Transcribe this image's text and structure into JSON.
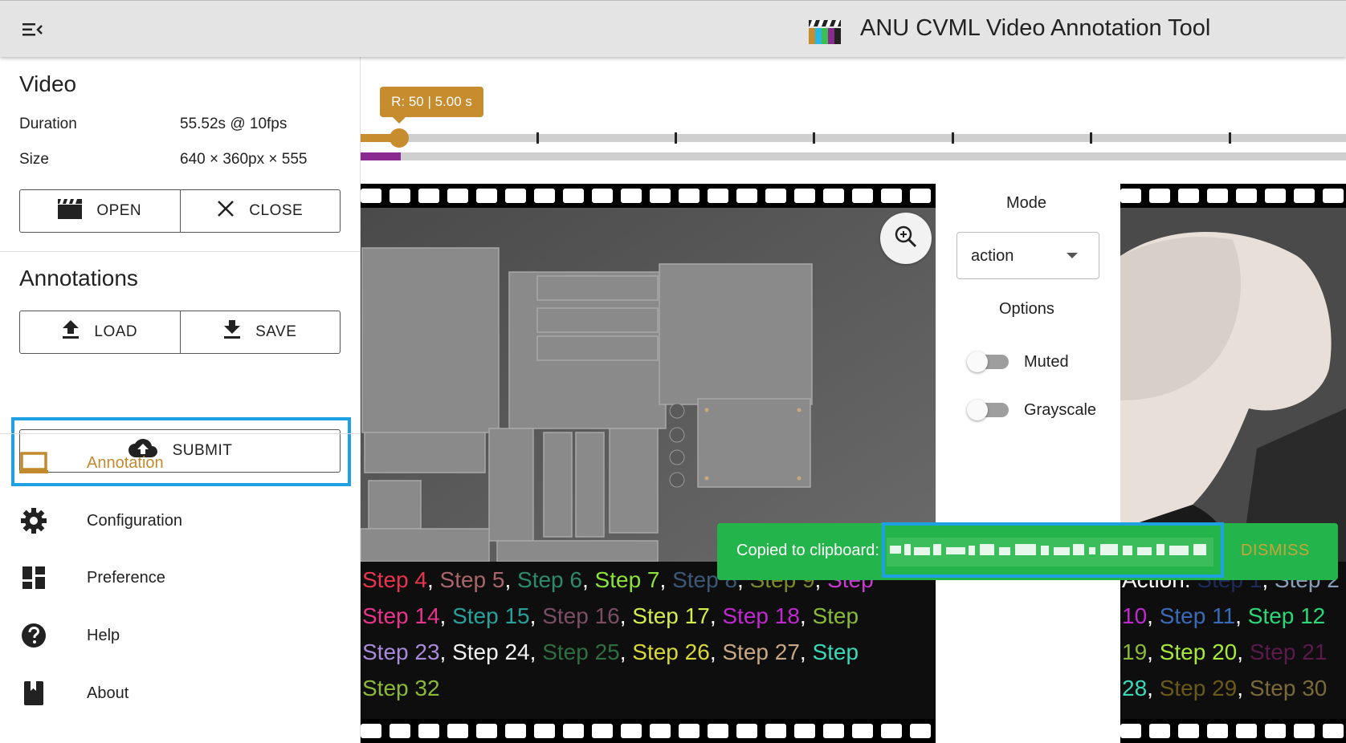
{
  "appbar": {
    "title": "ANU CVML Video Annotation Tool",
    "menu_icon": "menu-collapse-icon",
    "logo_icon": "clapperboard-logo-icon"
  },
  "sidebar": {
    "video": {
      "title": "Video",
      "duration_label": "Duration",
      "duration_value": "55.52s @ 10fps",
      "size_label": "Size",
      "size_value": "640 × 360px × 555",
      "open_label": "OPEN",
      "close_label": "CLOSE"
    },
    "annotations": {
      "title": "Annotations",
      "load_label": "LOAD",
      "save_label": "SAVE",
      "submit_label": "SUBMIT"
    },
    "nav": [
      {
        "label": "Annotation",
        "icon": "laptop-icon",
        "active": true
      },
      {
        "label": "Configuration",
        "icon": "gear-icon",
        "active": false
      },
      {
        "label": "Preference",
        "icon": "dashboard-icon",
        "active": false
      },
      {
        "label": "Help",
        "icon": "help-icon",
        "active": false
      },
      {
        "label": "About",
        "icon": "book-icon",
        "active": false
      }
    ]
  },
  "timeline": {
    "tooltip": "R: 50 | 5.00 s",
    "position_frame": 50,
    "total_frames": 555
  },
  "left_frame": {
    "lines": [
      [
        {
          "t": "Step 4",
          "c": "#e8344e"
        },
        {
          "t": ", ",
          "c": "#ffffff"
        },
        {
          "t": "Step 5",
          "c": "#a8656b"
        },
        {
          "t": ", ",
          "c": "#ffffff"
        },
        {
          "t": "Step 6",
          "c": "#2e8a6c"
        },
        {
          "t": ", ",
          "c": "#ffffff"
        },
        {
          "t": "Step 7",
          "c": "#8ee03a"
        },
        {
          "t": ", ",
          "c": "#ffffff"
        },
        {
          "t": "Step 8",
          "c": "#3c5878"
        },
        {
          "t": ", ",
          "c": "#ffffff"
        },
        {
          "t": "Step 9",
          "c": "#7a8a2a"
        },
        {
          "t": ", ",
          "c": "#ffffff"
        },
        {
          "t": "Step",
          "c": "#c83ad0"
        }
      ],
      [
        {
          "t": "Step 14",
          "c": "#e8348a"
        },
        {
          "t": ", ",
          "c": "#ffffff"
        },
        {
          "t": "Step 15",
          "c": "#2aa09a"
        },
        {
          "t": ", ",
          "c": "#ffffff"
        },
        {
          "t": "Step 16",
          "c": "#7a4e64"
        },
        {
          "t": ", ",
          "c": "#ffffff"
        },
        {
          "t": "Step 17",
          "c": "#d4ec4e"
        },
        {
          "t": ", ",
          "c": "#ffffff"
        },
        {
          "t": "Step 18",
          "c": "#c028d0"
        },
        {
          "t": ", ",
          "c": "#ffffff"
        },
        {
          "t": "Step",
          "c": "#8ab83a"
        }
      ],
      [
        {
          "t": "Step 23",
          "c": "#a88ad8"
        },
        {
          "t": ", ",
          "c": "#ffffff"
        },
        {
          "t": "Step 24",
          "c": "#f2f2f2"
        },
        {
          "t": ", ",
          "c": "#ffffff"
        },
        {
          "t": "Step 25",
          "c": "#2e6e40"
        },
        {
          "t": ", ",
          "c": "#ffffff"
        },
        {
          "t": "Step 26",
          "c": "#d8d838"
        },
        {
          "t": ", ",
          "c": "#ffffff"
        },
        {
          "t": "Step 27",
          "c": "#c8a882"
        },
        {
          "t": ", ",
          "c": "#ffffff"
        },
        {
          "t": "Step",
          "c": "#3ad8b8"
        }
      ],
      [
        {
          "t": "Step 32",
          "c": "#8ab83a"
        }
      ]
    ]
  },
  "right_frame": {
    "lines": [
      [
        {
          "t": "Action: ",
          "c": "#ffffff"
        },
        {
          "t": "Step 1",
          "c": "#1e2a5a"
        },
        {
          "t": ", ",
          "c": "#ffffff"
        },
        {
          "t": "Step 2",
          "c": "#8aa0b8"
        }
      ],
      [
        {
          "t": "10",
          "c": "#c028d0"
        },
        {
          "t": ", ",
          "c": "#ffffff"
        },
        {
          "t": "Step 11",
          "c": "#3a6ab8"
        },
        {
          "t": ", ",
          "c": "#ffffff"
        },
        {
          "t": "Step 12",
          "c": "#2ad87a"
        }
      ],
      [
        {
          "t": "19",
          "c": "#8ab83a"
        },
        {
          "t": ", ",
          "c": "#ffffff"
        },
        {
          "t": "Step 20",
          "c": "#a8e83a"
        },
        {
          "t": ", ",
          "c": "#ffffff"
        },
        {
          "t": "Step 21",
          "c": "#5a1a4a"
        }
      ],
      [
        {
          "t": "28",
          "c": "#3ad8b8"
        },
        {
          "t": ", ",
          "c": "#ffffff"
        },
        {
          "t": "Step 29",
          "c": "#6a5a1a"
        },
        {
          "t": ", ",
          "c": "#ffffff"
        },
        {
          "t": "Step 30",
          "c": "#7a6a3a"
        }
      ]
    ]
  },
  "controls": {
    "mode_label": "Mode",
    "mode_value": "action",
    "options_label": "Options",
    "muted_label": "Muted",
    "muted_on": false,
    "grayscale_label": "Grayscale",
    "grayscale_on": false,
    "zoom_icon": "zoom-in-icon"
  },
  "snackbar": {
    "text": "Copied to clipboard:",
    "dismiss_label": "DISMISS"
  },
  "colors": {
    "accent": "#c68c2e",
    "purple": "#8a2a91",
    "snackbar": "#23b54b",
    "highlight": "#1da1e2"
  }
}
